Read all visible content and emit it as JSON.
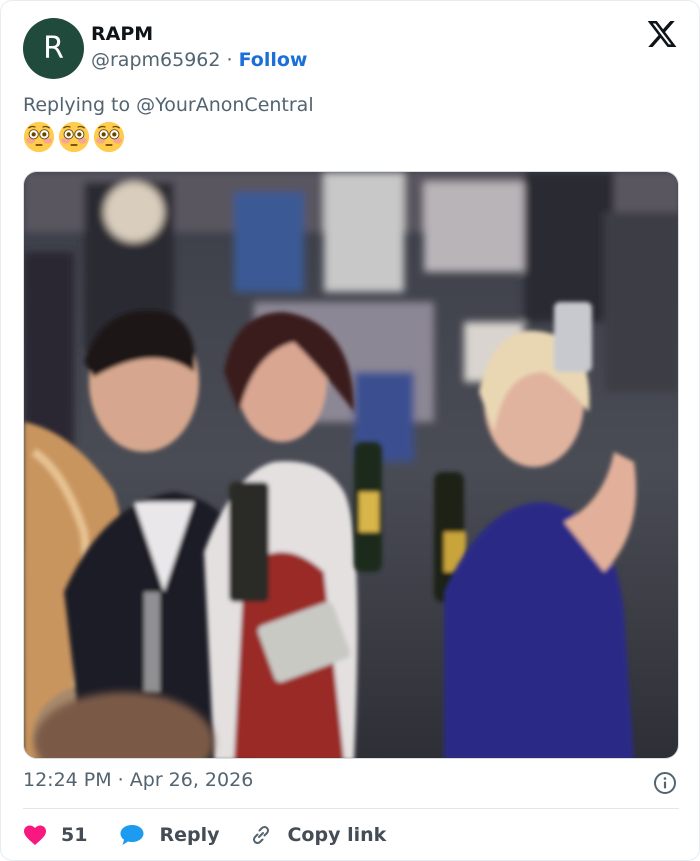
{
  "tweet": {
    "author": {
      "initial": "R",
      "name": "RAPM",
      "handle": "@rapm65962",
      "separator": " · ",
      "follow_label": "Follow"
    },
    "replying_prefix": "Replying to ",
    "replying_to": "@YourAnonCentral",
    "emojis": [
      "flushed-face-icon",
      "flushed-face-icon",
      "flushed-face-icon"
    ],
    "timestamp": "12:24 PM · Apr 26, 2026",
    "like_count": "51",
    "reply_label": "Reply",
    "copy_link_label": "Copy link"
  },
  "colors": {
    "avatar_bg": "#1f4a3c",
    "follow": "#1d6fd8",
    "like": "#f91880",
    "reply": "#1d9bf0"
  }
}
